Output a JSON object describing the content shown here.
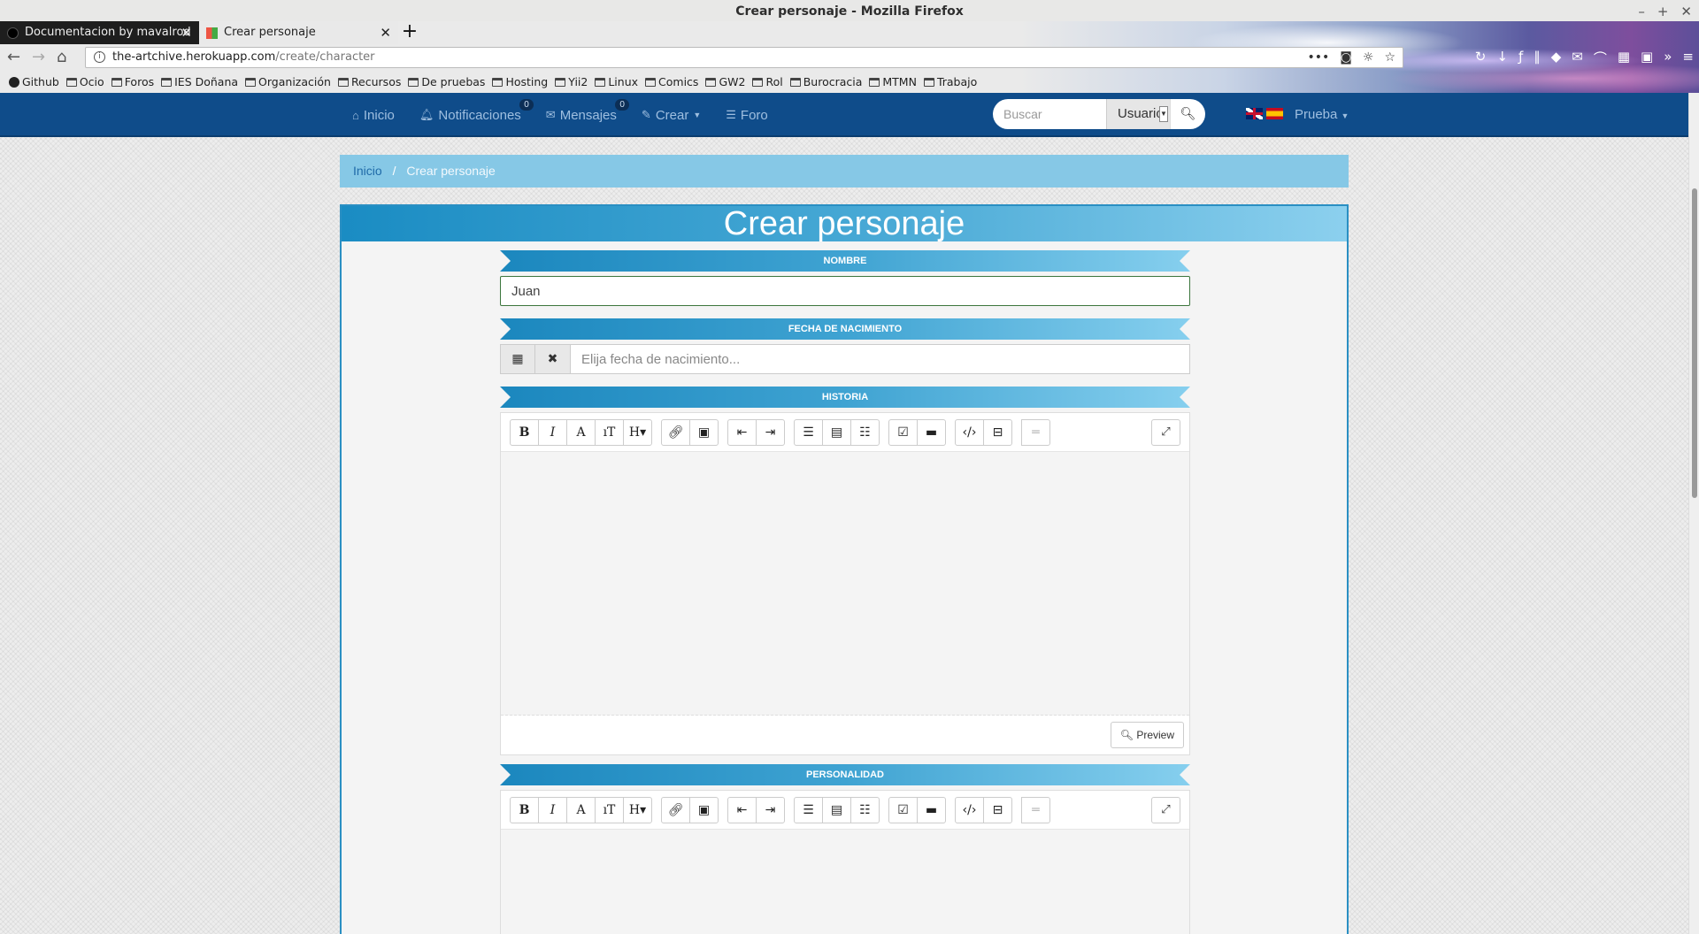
{
  "window": {
    "title": "Crear personaje - Mozilla Firefox"
  },
  "tabs": [
    {
      "label": "Documentacion by mavalrod",
      "active": false
    },
    {
      "label": "Crear personaje",
      "active": true
    }
  ],
  "urlbar": {
    "host": "the-artchive.herokuapp.com",
    "path": "/create/character"
  },
  "bookmarks": [
    "Github",
    "Ocio",
    "Foros",
    "IES Doñana",
    "Organización",
    "Recursos",
    "De pruebas",
    "Hosting",
    "Yii2",
    "Linux",
    "Comics",
    "GW2",
    "Rol",
    "Burocracia",
    "MTMN",
    "Trabajo"
  ],
  "site_nav": {
    "home": "Inicio",
    "notifications": "Notificaciones",
    "notifications_count": "0",
    "messages": "Mensajes",
    "messages_count": "0",
    "create": "Crear",
    "forum": "Foro",
    "search_placeholder": "Buscar",
    "search_scope": "Usuario",
    "user": "Prueba"
  },
  "breadcrumb": {
    "home": "Inicio",
    "current": "Crear personaje"
  },
  "card": {
    "title": "Crear personaje"
  },
  "form": {
    "name_label": "NOMBRE",
    "name_value": "Juan",
    "birth_label": "FECHA DE NACIMIENTO",
    "birth_placeholder": "Elija fecha de nacimiento...",
    "history_label": "HISTORIA",
    "personality_label": "PERSONALIDAD",
    "preview_label": "Preview"
  },
  "colors": {
    "site_nav": "#0f4c8a",
    "breadcrumb": "#86c8e6",
    "accent": "#2a8fc3"
  }
}
